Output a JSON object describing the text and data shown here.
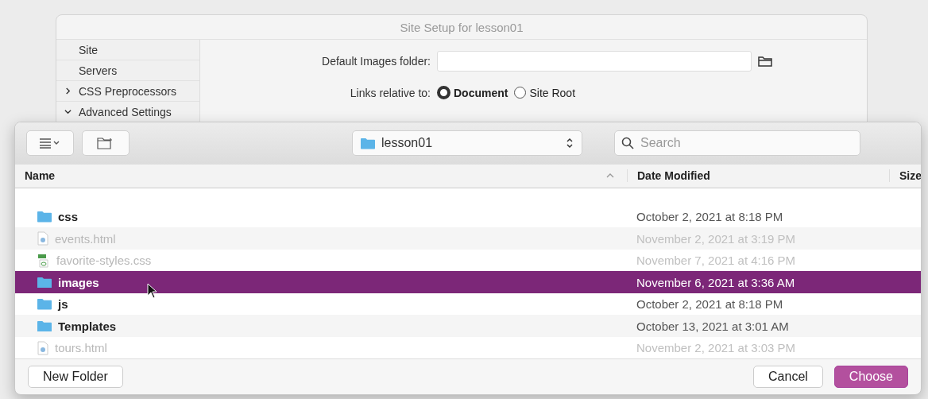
{
  "back_window": {
    "title": "Site Setup for lesson01",
    "sidebar": [
      {
        "label": "Site",
        "kind": "page"
      },
      {
        "label": "Servers",
        "kind": "page"
      },
      {
        "label": "CSS Preprocessors",
        "kind": "group",
        "expanded": false
      },
      {
        "label": "Advanced Settings",
        "kind": "group",
        "expanded": true
      }
    ],
    "images_folder": {
      "label": "Default Images folder:"
    },
    "links": {
      "label": "Links relative to:",
      "options": [
        {
          "label": "Document",
          "selected": true
        },
        {
          "label": "Site Root",
          "selected": false
        }
      ]
    }
  },
  "dialog": {
    "location": "lesson01",
    "search": {
      "placeholder": "Search"
    },
    "columns": [
      "Name",
      "Date Modified",
      "Size"
    ],
    "rows": [
      {
        "name": "css",
        "kind": "folder",
        "date": "October 2, 2021 at 8:18 PM",
        "disabled": false,
        "selected": false
      },
      {
        "name": "events.html",
        "kind": "html",
        "date": "November 2, 2021 at 3:19 PM",
        "disabled": true,
        "selected": false
      },
      {
        "name": "favorite-styles.css",
        "kind": "css",
        "date": "November 7, 2021 at 4:16 PM",
        "disabled": true,
        "selected": false
      },
      {
        "name": "images",
        "kind": "folder",
        "date": "November 6, 2021 at 3:36 AM",
        "disabled": false,
        "selected": true
      },
      {
        "name": "js",
        "kind": "folder",
        "date": "October 2, 2021 at 8:18 PM",
        "disabled": false,
        "selected": false
      },
      {
        "name": "Templates",
        "kind": "folder",
        "date": "October 13, 2021 at 3:01 AM",
        "disabled": false,
        "selected": false
      },
      {
        "name": "tours.html",
        "kind": "html",
        "date": "November 2, 2021 at 3:03 PM",
        "disabled": true,
        "selected": false
      }
    ],
    "buttons": {
      "new_folder": "New Folder",
      "cancel": "Cancel",
      "choose": "Choose"
    }
  }
}
